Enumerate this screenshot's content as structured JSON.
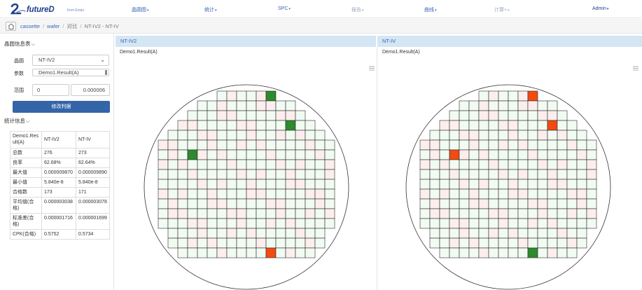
{
  "navbar": {
    "logo_text": "futureD",
    "logo_sub": "from Eoulu",
    "items": [
      {
        "label": "晶圆图",
        "dim": false
      },
      {
        "label": "统计",
        "dim": false
      },
      {
        "label": "SPC",
        "dim": false
      },
      {
        "label": "报告",
        "dim": true
      },
      {
        "label": "曲线",
        "dim": false
      },
      {
        "label": "计算+",
        "dim": true
      },
      {
        "label": "Admin",
        "dim": false
      }
    ]
  },
  "breadcrumb": [
    "cassette",
    "wafer",
    "对比",
    "NT-IV2 - NT-IV"
  ],
  "left": {
    "wafer_info_title": "晶圆信息表",
    "wafer_label": "晶圆",
    "wafer_value": "NT-IV2",
    "param_label": "参数",
    "param_value": "Demo1.Result(A)",
    "range_label": "范围",
    "range_min": "0",
    "range_max": "0.000006",
    "apply_button": "修改判据",
    "stats_title": "统计信息",
    "stats_table": {
      "header": [
        "Demo1.Result(A)",
        "NT-IV2",
        "NT-IV"
      ],
      "rows": [
        [
          "总数",
          "276",
          "273"
        ],
        [
          "良率",
          "62.68%",
          "62.64%"
        ],
        [
          "最大值",
          "0.000009870",
          "0.000009890"
        ],
        [
          "最小值",
          "5.840e-8",
          "5.840e-8"
        ],
        [
          "合格数",
          "173",
          "171"
        ],
        [
          "平均值(合格)",
          "0.000003038",
          "0.000003078"
        ],
        [
          "标准差(合格)",
          "0.000001716",
          "0.000001699"
        ],
        [
          "CPK(合格)",
          "0.5752",
          "0.5734"
        ]
      ]
    }
  },
  "maps": [
    {
      "header": "NT-IV2",
      "parameter": "Demo1.Result(A)",
      "special_dies": [
        {
          "row": 0,
          "col": 11,
          "status": "green"
        },
        {
          "row": 3,
          "col": 13,
          "status": "green"
        },
        {
          "row": 6,
          "col": 3,
          "status": "green"
        },
        {
          "row": 16,
          "col": 11,
          "status": "red"
        }
      ]
    },
    {
      "header": "NT-IV",
      "parameter": "Demo1.Result(A)",
      "special_dies": [
        {
          "row": 0,
          "col": 11,
          "status": "red"
        },
        {
          "row": 3,
          "col": 13,
          "status": "red"
        },
        {
          "row": 6,
          "col": 3,
          "status": "red"
        },
        {
          "row": 16,
          "col": 11,
          "status": "green"
        }
      ]
    }
  ],
  "colors": {
    "accent": "#3465a8",
    "panel_header": "#d4e6f3",
    "pass_die": "#f1fbf2",
    "fail_die": "#fdeeee",
    "green_die": "#2d8a2d",
    "red_die": "#f24b12"
  }
}
